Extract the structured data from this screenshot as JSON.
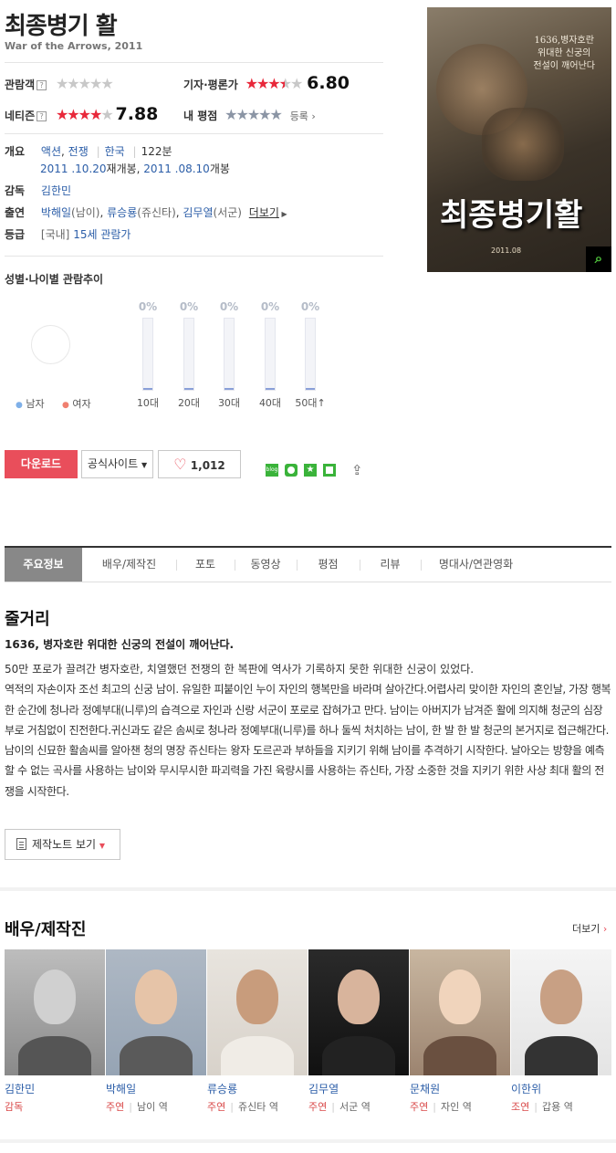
{
  "movie": {
    "title": "최종병기 활",
    "subtitle": "War of the Arrows, 2011"
  },
  "ratings": {
    "audience_label": "관람객",
    "critic_label": "기자·평론가",
    "critic_score": "6.80",
    "netizen_label": "네티즌",
    "netizen_score": "7.88",
    "my_label": "내 평점",
    "register_label": "등록",
    "critic_stars": 3.4,
    "netizen_stars": 3.9
  },
  "info": {
    "overview_key": "개요",
    "genre1": "액션",
    "genre2": "전쟁",
    "country": "한국",
    "runtime": "122분",
    "release1": "2011 .10.20",
    "release1_tag": "재개봉",
    "release2": "2011 .08.10",
    "release2_tag": "개봉",
    "director_key": "감독",
    "director": "김한민",
    "cast_key": "출연",
    "cast1": "박해일",
    "cast1_role": "(남이)",
    "cast2": "류승룡",
    "cast2_role": "(쥬신타)",
    "cast3": "김무열",
    "cast3_role": "(서군)",
    "more": "더보기",
    "grade_key": "등급",
    "grade_prefix": "[국내]",
    "grade": "15세 관람가"
  },
  "poster": {
    "tagline": "1636,병자호란\n위대한 신궁의\n전설이 깨어난다",
    "title": "최종병기활",
    "date": "2011.08"
  },
  "demographics": {
    "title": "성별·나이별 관람추이",
    "male": "남자",
    "female": "여자",
    "groups": [
      {
        "label": "10대",
        "pct": "0%"
      },
      {
        "label": "20대",
        "pct": "0%"
      },
      {
        "label": "30대",
        "pct": "0%"
      },
      {
        "label": "40대",
        "pct": "0%"
      },
      {
        "label": "50대↑",
        "pct": "0%"
      }
    ]
  },
  "actions": {
    "download": "다운로드",
    "official_site": "공식사이트",
    "likes": "1,012"
  },
  "tabs": [
    "주요정보",
    "배우/제작진",
    "포토",
    "동영상",
    "평점",
    "리뷰",
    "명대사/연관영화"
  ],
  "synopsis": {
    "heading": "줄거리",
    "headline": "1636, 병자호란 위대한 신궁의 전설이 깨어난다.",
    "paragraph1": "50만 포로가 끌려간 병자호란, 치열했던 전쟁의 한 복판에 역사가 기록하지 못한 위대한 신궁이 있었다.",
    "paragraph2": " 역적의 자손이자 조선 최고의 신궁 남이. 유일한 피붙이인 누이 자인의 행복만을 바라며 살아간다.어렵사리 맞이한 자인의 혼인날, 가장 행복한 순간에 청나라 정예부대(니루)의 습격으로 자인과 신랑 서군이 포로로 잡혀가고 만다. 남이는 아버지가 남겨준 활에 의지해 청군의 심장부로 거침없이 진전한다.귀신과도 같은 솜씨로 청나라 정예부대(니루)를 하나 둘씩 처치하는 남이, 한 발 한 발 청군의 본거지로 접근해간다. 남이의 신묘한 활솜씨를 알아챈 청의 명장 쥬신타는 왕자 도르곤과 부하들을 지키기 위해 남이를 추격하기 시작한다. 날아오는 방향을 예측할 수 없는 곡사를 사용하는 남이와 무시무시한 파괴력을 가진 육량시를 사용하는 쥬신타, 가장 소중한 것을 지키기 위한 사상 최대 활의 전쟁을 시작한다.",
    "notes_button": "제작노트 보기"
  },
  "cast_section": {
    "heading": "배우/제작진",
    "more": "더보기",
    "people": [
      {
        "name": "김한민",
        "type": "감독",
        "role": ""
      },
      {
        "name": "박해일",
        "type": "주연",
        "role": "남이 역"
      },
      {
        "name": "류승룡",
        "type": "주연",
        "role": "쥬신타 역"
      },
      {
        "name": "김무열",
        "type": "주연",
        "role": "서군 역"
      },
      {
        "name": "문채원",
        "type": "주연",
        "role": "자인 역"
      },
      {
        "name": "이한위",
        "type": "조연",
        "role": "갑용 역"
      }
    ]
  },
  "colors": {
    "accent_red": "#e94e5b",
    "link_blue": "#2c5ea8",
    "star_red": "#e8283a"
  }
}
